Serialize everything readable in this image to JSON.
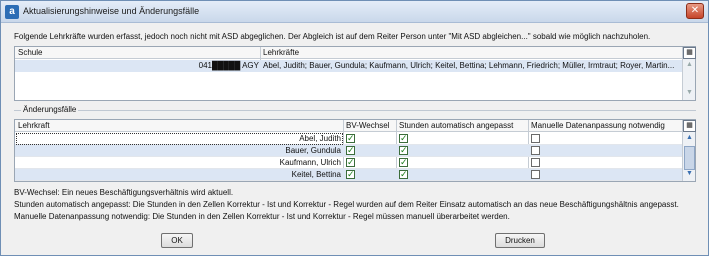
{
  "window": {
    "title": "Aktualisierungshinweise und Änderungsfälle"
  },
  "info_text": "Folgende Lehrkräfte wurden erfasst, jedoch noch nicht mit ASD abgeglichen. Der Abgleich ist auf dem Reiter Person unter \"Mit ASD abgleichen...\" sobald wie möglich nachzuholen.",
  "grid_unsynced": {
    "columns": [
      "Schule",
      "Lehrkräfte"
    ],
    "rows": [
      {
        "schule": "041█████ AGY",
        "lehrkraefte": "Abel, Judith; Bauer, Gundula; Kaufmann, Ulrich; Keitel, Bettina; Lehmann, Friedrich; Müller, Irmtraut; Royer, Martin..."
      }
    ]
  },
  "section_label": "Änderungsfälle",
  "grid_changes": {
    "columns": [
      "Lehrkraft",
      "BV-Wechsel",
      "Stunden automatisch angepasst",
      "Manuelle Datenanpassung notwendig"
    ],
    "rows": [
      {
        "name": "Abel, Judith",
        "bv": true,
        "stunden": true,
        "manuell": false
      },
      {
        "name": "Bauer, Gundula",
        "bv": true,
        "stunden": true,
        "manuell": false
      },
      {
        "name": "Kaufmann, Ulrich",
        "bv": true,
        "stunden": true,
        "manuell": false
      },
      {
        "name": "Keitel, Bettina",
        "bv": true,
        "stunden": true,
        "manuell": false
      }
    ]
  },
  "legend": [
    "BV-Wechsel: Ein neues Beschäftigungsverhältnis wird aktuell.",
    "Stunden automatisch angepasst: Die Stunden in den Zellen Korrektur - Ist und Korrektur - Regel wurden auf dem Reiter Einsatz automatisch an das neue Beschäftigungshältnis angepasst.",
    "Manuelle Datenanpassung notwendig: Die Stunden in den Zellen Korrektur - Ist und Korrektur - Regel müssen manuell überarbeitet werden."
  ],
  "buttons": {
    "ok": "OK",
    "print": "Drucken"
  },
  "icons": {
    "app": "app-logo-icon",
    "close": "close-icon",
    "column_chooser": "column-chooser-icon"
  },
  "colors": {
    "row_highlight": "#dce6f4",
    "check_green": "#1b7d1b",
    "close_red": "#c6452a"
  }
}
